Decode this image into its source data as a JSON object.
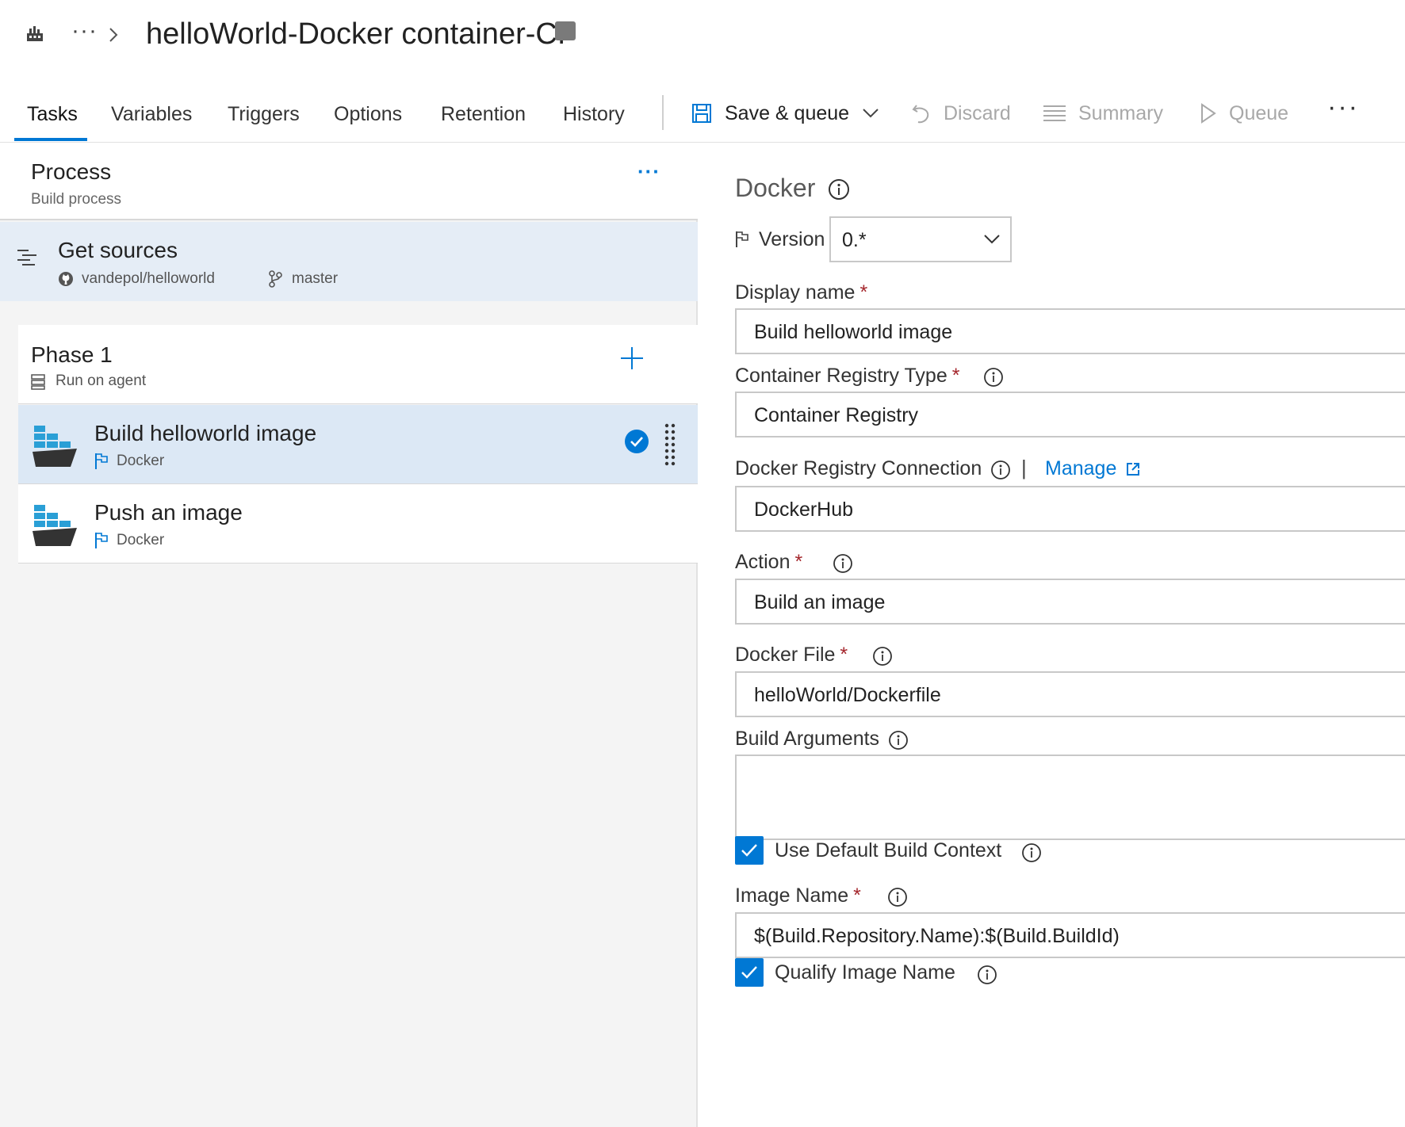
{
  "header": {
    "breadcrumb_ellipsis": "···",
    "title": "helloWorld-Docker container-CI"
  },
  "tabs": [
    {
      "label": "Tasks",
      "active": true
    },
    {
      "label": "Variables"
    },
    {
      "label": "Triggers"
    },
    {
      "label": "Options"
    },
    {
      "label": "Retention"
    },
    {
      "label": "History"
    }
  ],
  "toolbar": {
    "save_queue": "Save & queue",
    "discard": "Discard",
    "summary": "Summary",
    "queue": "Queue",
    "more": "···"
  },
  "process": {
    "title": "Process",
    "subtitle": "Build process",
    "more": "···"
  },
  "sources": {
    "title": "Get sources",
    "repo": "vandepol/helloworld",
    "branch": "master"
  },
  "phase": {
    "title": "Phase 1",
    "subtitle": "Run on agent"
  },
  "tasks": [
    {
      "title": "Build helloworld image",
      "type": "Docker",
      "selected": true
    },
    {
      "title": "Push an image",
      "type": "Docker",
      "selected": false
    }
  ],
  "details": {
    "header": "Docker",
    "version_label": "Version",
    "version_value": "0.*",
    "display_name": {
      "label": "Display name",
      "value": "Build helloworld image",
      "required": "*"
    },
    "registry_type": {
      "label": "Container Registry Type",
      "value": "Container Registry",
      "required": "*"
    },
    "registry_connection": {
      "label": "Docker Registry Connection",
      "separator": "|",
      "manage": "Manage",
      "value": "DockerHub"
    },
    "action": {
      "label": "Action",
      "value": "Build an image",
      "required": "*"
    },
    "docker_file": {
      "label": "Docker File",
      "value": "helloWorld/Dockerfile",
      "required": "*"
    },
    "build_args": {
      "label": "Build Arguments",
      "value": ""
    },
    "default_context": {
      "label": "Use Default Build Context",
      "checked": true
    },
    "image_name": {
      "label": "Image Name",
      "value": "$(Build.Repository.Name):$(Build.BuildId)",
      "required": "*"
    },
    "qualify_image": {
      "label": "Qualify Image Name",
      "checked": true
    }
  },
  "colors": {
    "accent": "#0078d4",
    "selected_bg": "#dce8f5",
    "required": "#a4262c"
  }
}
